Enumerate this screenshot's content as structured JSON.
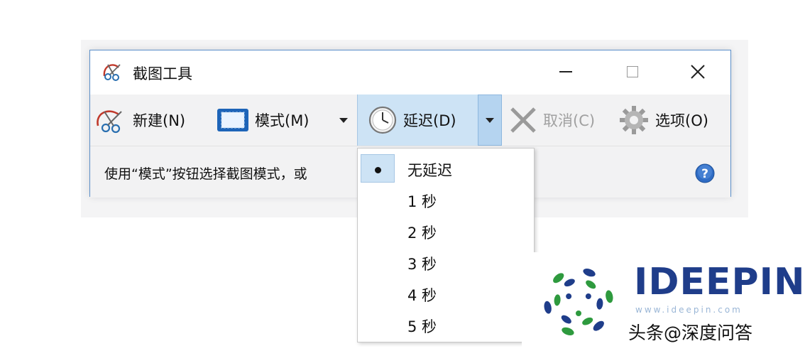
{
  "window": {
    "title": "截图工具",
    "app_icon": "snipping-tool-icon",
    "controls": {
      "minimize": "minimize-icon",
      "maximize": "maximize-icon",
      "close": "close-icon",
      "close_glyph": "✕"
    }
  },
  "toolbar": {
    "new_label": "新建(N)",
    "new_icon": "snipping-scissors-icon",
    "mode_label": "模式(M)",
    "mode_icon": "rectangle-mode-icon",
    "delay_label": "延迟(D)",
    "delay_icon": "clock-icon",
    "cancel_label": "取消(C)",
    "cancel_icon": "x-cancel-icon",
    "options_label": "选项(O)",
    "options_icon": "gear-icon"
  },
  "status": {
    "text": "使用“模式”按钮选择截图模式，或",
    "help_icon": "help-icon",
    "help_glyph": "?"
  },
  "delay_menu": {
    "items": [
      "无延迟",
      "1 秒",
      "2 秒",
      "3 秒",
      "4 秒",
      "5 秒"
    ],
    "selected": "无延迟"
  },
  "watermark": {
    "brand": "IDEEPIN",
    "sub": "www.ideepin.com",
    "handle": "头条@深度问答"
  },
  "colors": {
    "accent_blue": "#cde3f5",
    "window_border": "#5b8fc9",
    "disabled_text": "#a0a0a0",
    "brand_blue": "#1f3d8a",
    "logo_green": "#2e9a3e"
  }
}
